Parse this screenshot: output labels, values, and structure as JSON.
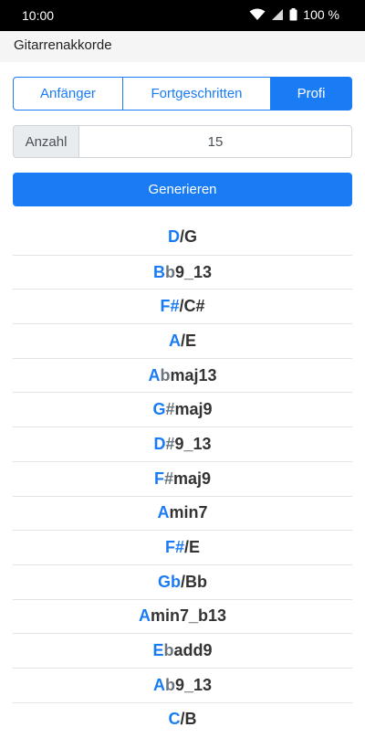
{
  "status_bar": {
    "time": "10:00",
    "battery": "100 %"
  },
  "app_title": "Gitarrenakkorde",
  "levels": [
    {
      "label": "Anfänger",
      "active": false
    },
    {
      "label": "Fortgeschritten",
      "active": false
    },
    {
      "label": "Profi",
      "active": true
    }
  ],
  "count": {
    "label": "Anzahl",
    "value": "15"
  },
  "generate_label": "Generieren",
  "chords": [
    {
      "root": "D",
      "acc": "",
      "rest": "/G"
    },
    {
      "root": "B",
      "acc": "b",
      "rest": "9_13"
    },
    {
      "root": "F#",
      "acc": "",
      "rest": "/C#"
    },
    {
      "root": "A",
      "acc": "",
      "rest": "/E"
    },
    {
      "root": "A",
      "acc": "b",
      "rest": "maj13"
    },
    {
      "root": "G",
      "acc": "#",
      "rest": "maj9"
    },
    {
      "root": "D",
      "acc": "#",
      "rest": "9_13"
    },
    {
      "root": "F",
      "acc": "#",
      "rest": "maj9"
    },
    {
      "root": "A",
      "acc": "",
      "rest": "min7"
    },
    {
      "root": "F#",
      "acc": "",
      "rest": "/E"
    },
    {
      "root": "Gb",
      "acc": "",
      "rest": "/Bb"
    },
    {
      "root": "A",
      "acc": "",
      "rest": "min7_b13"
    },
    {
      "root": "E",
      "acc": "b",
      "rest": "add9"
    },
    {
      "root": "A",
      "acc": "b",
      "rest": "9_13"
    },
    {
      "root": "C",
      "acc": "",
      "rest": "/B"
    }
  ],
  "colors": {
    "accent": "#1a7cf5",
    "accidental": "#6c757d",
    "text": "#333333"
  }
}
